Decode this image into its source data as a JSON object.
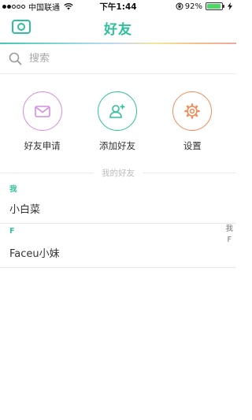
{
  "status": {
    "carrier": "中国联通",
    "time": "下午1:44",
    "battery": "92%",
    "battery_level": 0.92
  },
  "header": {
    "title": "好友"
  },
  "search": {
    "placeholder": "搜索"
  },
  "actions": [
    {
      "label": "好友申请",
      "icon": "mail-icon",
      "color": "#d28de0"
    },
    {
      "label": "添加好友",
      "icon": "add-user-icon",
      "color": "#2fbf9b"
    },
    {
      "label": "设置",
      "icon": "gear-icon",
      "color": "#f28c5a"
    }
  ],
  "friends": {
    "divider_label": "我的好友",
    "sections": [
      {
        "letter": "我",
        "items": [
          "小白菜"
        ]
      },
      {
        "letter": "F",
        "items": [
          "Faceu小妹"
        ]
      }
    ],
    "index": [
      "我",
      "F"
    ]
  },
  "colors": {
    "accent": "#2fbf9b"
  }
}
